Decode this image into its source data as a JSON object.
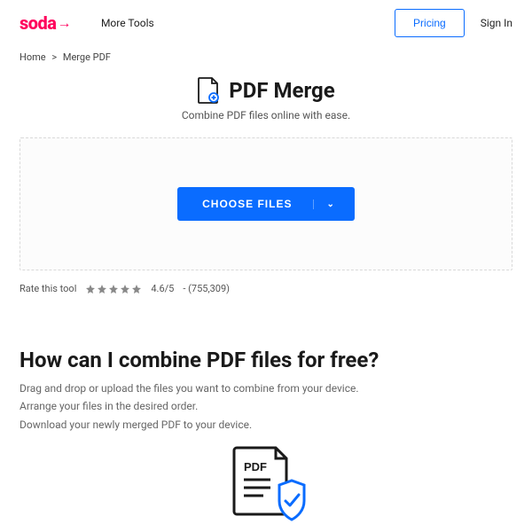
{
  "header": {
    "logo": "soda",
    "more_tools": "More Tools",
    "pricing": "Pricing",
    "sign_in": "Sign In"
  },
  "breadcrumb": {
    "home": "Home",
    "sep": ">",
    "current": "Merge PDF"
  },
  "title": "PDF Merge",
  "subtitle": "Combine PDF files online with ease.",
  "choose_files_label": "CHOOSE FILES",
  "rating": {
    "label": "Rate this tool",
    "score": "4.6/5",
    "count_text": "- (755,309)"
  },
  "section": {
    "heading": "How can I combine PDF files for free?",
    "step1": "Drag and drop or upload the files you want to combine from your device.",
    "step2": "Arrange your files in the desired order.",
    "step3": "Download your newly merged PDF to your device."
  },
  "colors": {
    "brand": "#ff005c",
    "primary": "#0a6cff"
  }
}
